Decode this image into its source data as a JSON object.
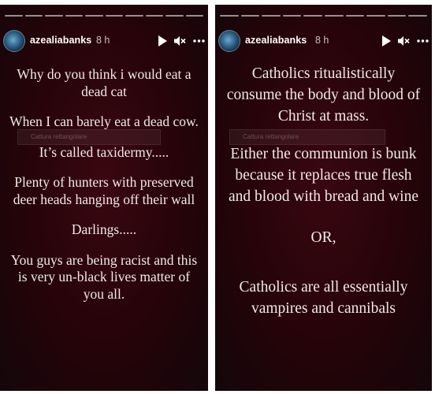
{
  "stories": [
    {
      "username": "azealiabanks",
      "timestamp": "8 h",
      "watermark": "Cattura rettangolare",
      "paragraphs": [
        "Why do you think i would eat a dead cat",
        "When I can barely eat a dead cow.",
        "It’s called taxidermy.....",
        "Plenty of hunters with preserved deer heads hanging off their wall",
        "Darlings.....",
        "You guys are being racist and this is very un-black lives matter of you all."
      ]
    },
    {
      "username": "azealiabanks",
      "timestamp": "8 h",
      "watermark": "Cattura rettangolare",
      "paragraphs": [
        "Catholics ritualistically consume the body and blood of Christ at mass.",
        "Either the communion is bunk because it replaces true flesh and blood with bread and wine",
        "OR,",
        "Catholics are all essentially vampires and cannibals"
      ]
    }
  ],
  "icons": {
    "play": "play-icon",
    "mute": "speaker-muted-icon",
    "more": "more-options-icon",
    "avatar": "profile-avatar"
  },
  "colors": {
    "story_background": "#250409",
    "text": "#f1e9e9",
    "progress": "#ffffff"
  }
}
